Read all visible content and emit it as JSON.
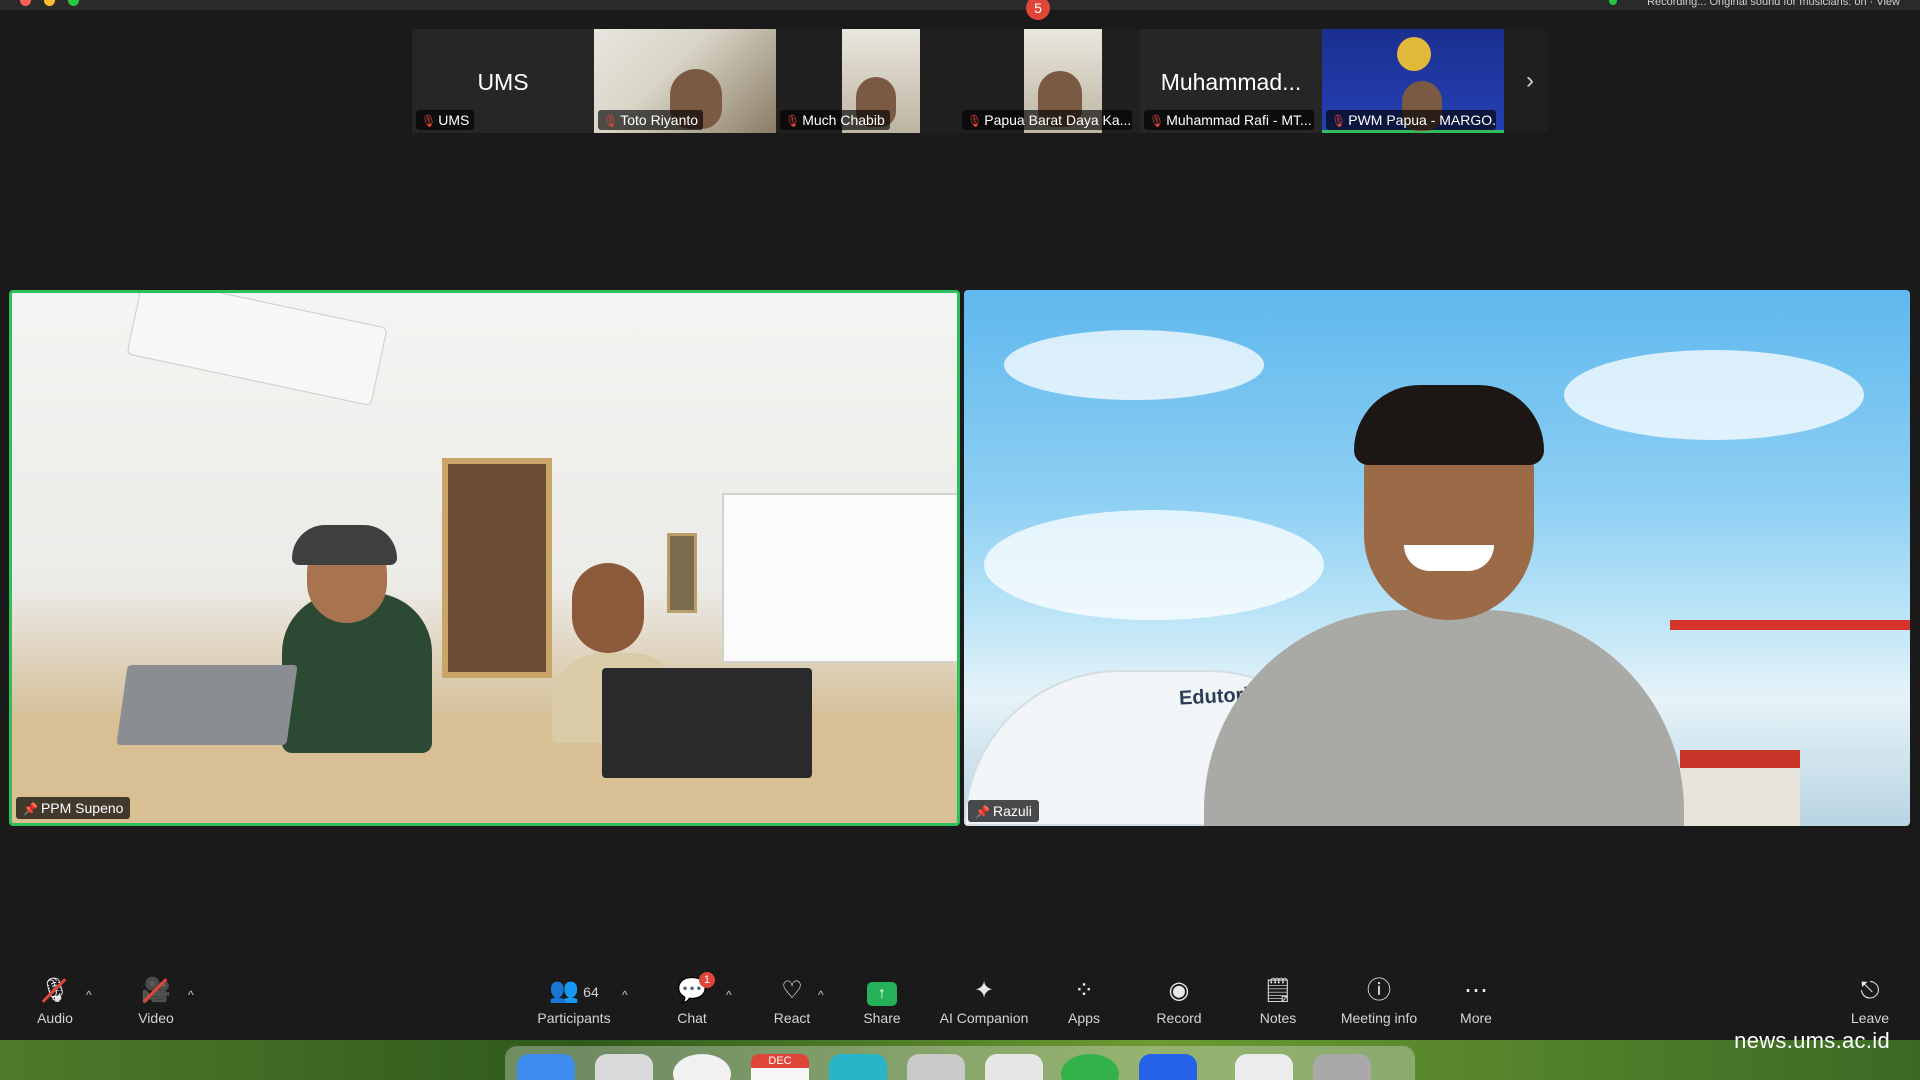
{
  "top_bar": {
    "status_text": "Recording... Original sound for musicians: on · View"
  },
  "thumbnails": [
    {
      "big_name": "UMS",
      "caption": "UMS"
    },
    {
      "big_name": "",
      "caption": "Toto Riyanto"
    },
    {
      "big_name": "",
      "caption": "Much Chabib"
    },
    {
      "big_name": "",
      "caption": "Papua Barat Daya Ka..."
    },
    {
      "big_name": "Muhammad...",
      "caption": "Muhammad Rafi - MT..."
    },
    {
      "big_name": "",
      "caption": "PWM Papua - MARGO..."
    }
  ],
  "main": {
    "left_name": "PPM Supeno",
    "right_name": "Razuli",
    "right_background_text": "Edutorium"
  },
  "toolbar": {
    "audio": "Audio",
    "video": "Video",
    "participants": "Participants",
    "participants_count": "64",
    "chat": "Chat",
    "chat_badge": "1",
    "react": "React",
    "share": "Share",
    "ai_companion": "AI Companion",
    "apps": "Apps",
    "record": "Record",
    "notes": "Notes",
    "meeting_info": "Meeting info",
    "more": "More",
    "leave": "Leave"
  },
  "dock": {
    "calendar_month": "DEC",
    "badge": "5"
  },
  "watermark": "news.ums.ac.id",
  "colors": {
    "active_speaker": "#2fbf5a",
    "muted": "#e0453a",
    "share": "#25b15a",
    "background": "#1a1a1a"
  }
}
